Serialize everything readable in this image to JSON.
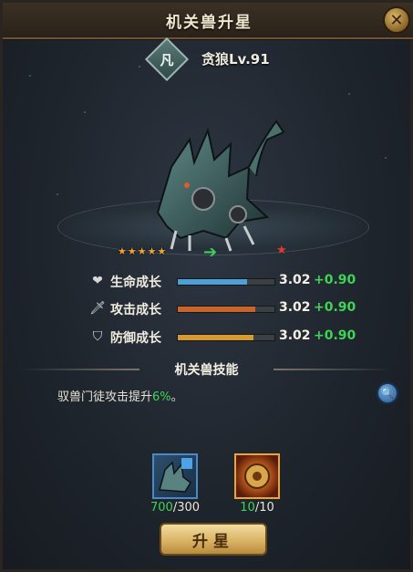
{
  "window": {
    "title": "机关兽升星"
  },
  "beast": {
    "rarity_char": "凡",
    "name": "贪狼Lv.91",
    "stars_current": 5,
    "stars_next": 6
  },
  "stats": [
    {
      "label": "生命成长",
      "value": "3.02",
      "gain": "+0.90",
      "fill": 0.72,
      "color": "#4f9ed6",
      "icon": "heart-icon"
    },
    {
      "label": "攻击成长",
      "value": "3.02",
      "gain": "+0.90",
      "fill": 0.8,
      "color": "#c8652a",
      "icon": "dagger-icon"
    },
    {
      "label": "防御成长",
      "value": "3.02",
      "gain": "+0.90",
      "fill": 0.78,
      "color": "#d79a2f",
      "icon": "shield-icon"
    }
  ],
  "skill": {
    "header": "机关兽技能",
    "desc_prefix": "驭兽门徒攻击提升",
    "desc_pct": "6%",
    "desc_suffix": "。"
  },
  "materials": [
    {
      "have": "700",
      "need": "/300"
    },
    {
      "have": "10",
      "need": "/10"
    }
  ],
  "actions": {
    "upgrade_label": "升星"
  },
  "colors": {
    "gain": "#3fd457",
    "accent": "#d7b061"
  }
}
